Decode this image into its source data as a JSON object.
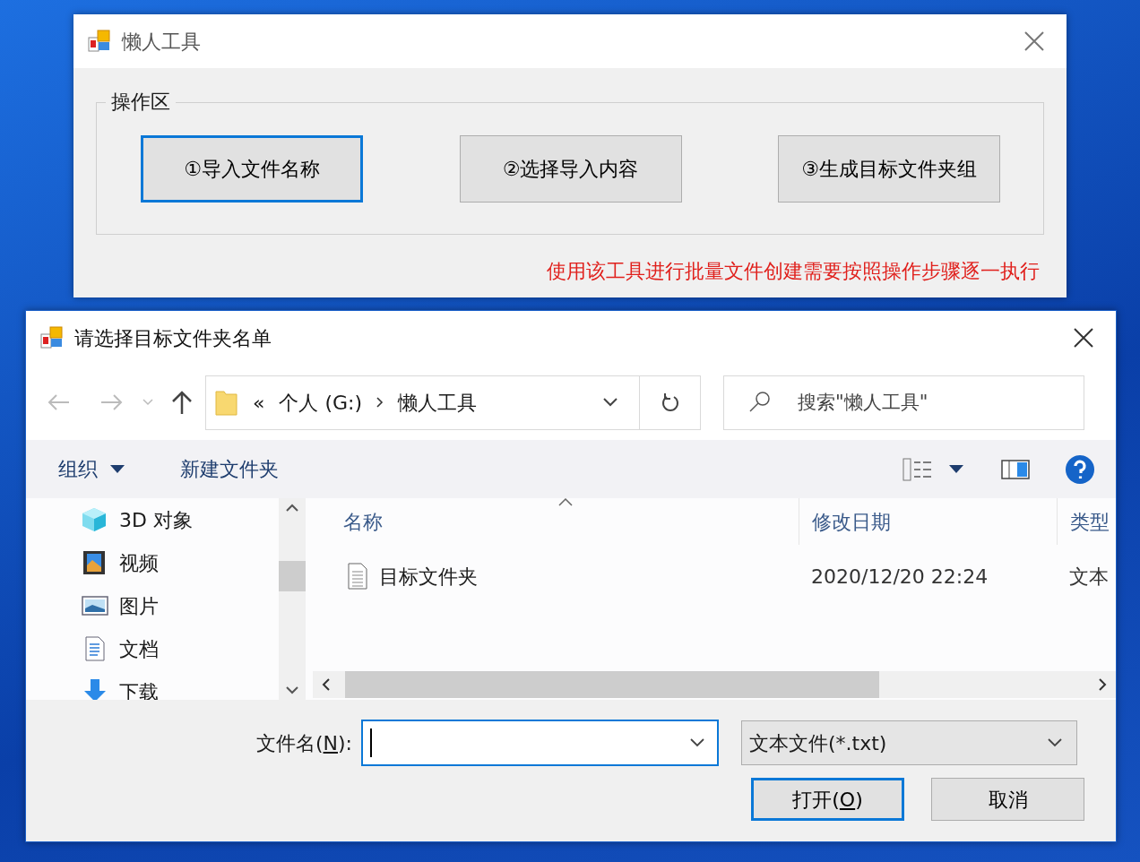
{
  "main_window": {
    "title": "懒人工具",
    "group_title": "操作区",
    "buttons": [
      {
        "label": "①导入文件名称",
        "focused": true
      },
      {
        "label": "②选择导入内容",
        "focused": false
      },
      {
        "label": "③生成目标文件夹组",
        "focused": false
      }
    ],
    "note": "使用该工具进行批量文件创建需要按照操作步骤逐一执行"
  },
  "dialog": {
    "title": "请选择目标文件夹名单",
    "address": {
      "overflow": "«",
      "segments": [
        "个人 (G:)",
        "懒人工具"
      ]
    },
    "search": {
      "placeholder": "搜索\"懒人工具\""
    },
    "toolbar": {
      "organize": "组织",
      "new_folder": "新建文件夹"
    },
    "sidebar": {
      "items": [
        {
          "label": "3D 对象",
          "kind": "cube"
        },
        {
          "label": "视频",
          "kind": "video"
        },
        {
          "label": "图片",
          "kind": "picture"
        },
        {
          "label": "文档",
          "kind": "document"
        },
        {
          "label": "下载",
          "kind": "download"
        }
      ]
    },
    "table": {
      "columns": [
        "名称",
        "修改日期",
        "类型"
      ],
      "rows": [
        {
          "name": "目标文件夹",
          "modified": "2020/12/20 22:24",
          "type": "文本",
          "selected": false
        }
      ]
    },
    "file_name": {
      "label": {
        "before": "文件名(",
        "key": "N",
        "after": "):"
      },
      "focused": true
    },
    "file_type": {
      "value": "文本文件(*.txt)"
    },
    "open_button": {
      "label": {
        "before": "打开(",
        "key": "O",
        "after": ")"
      },
      "focused": true
    },
    "cancel_button": {
      "label": "取消"
    }
  }
}
